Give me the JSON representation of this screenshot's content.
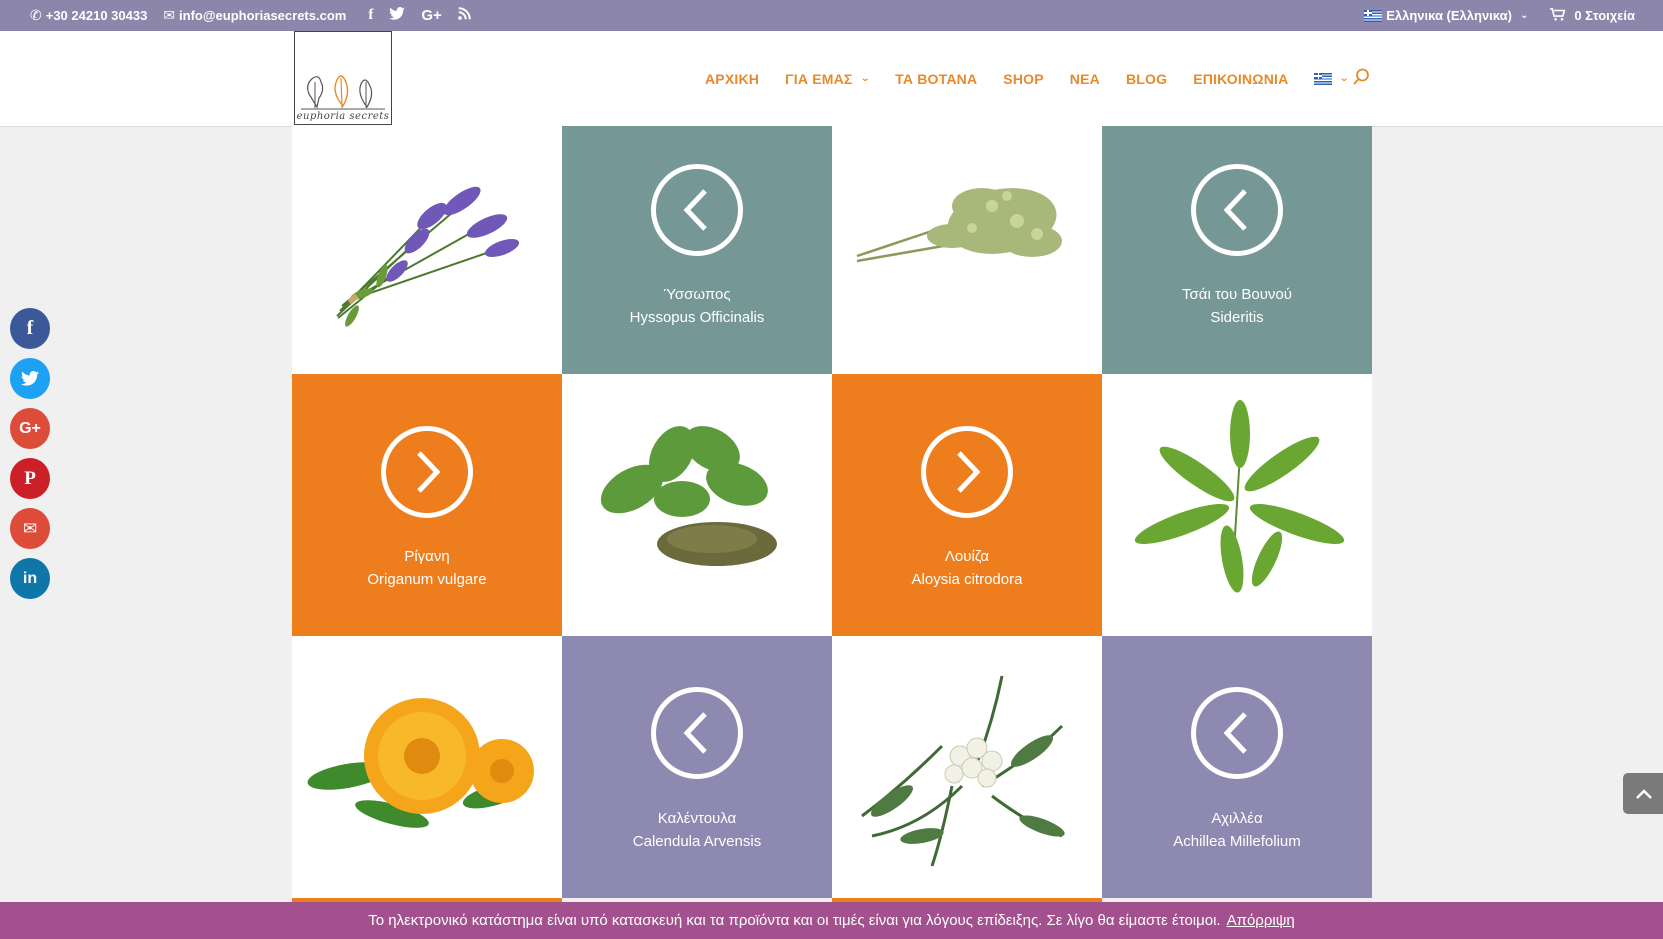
{
  "topbar": {
    "phone": "+30 24210 30433",
    "email": "info@euphoriasecrets.com",
    "social_icons": [
      "facebook-icon",
      "twitter-icon",
      "google-plus-icon",
      "rss-icon"
    ],
    "language": "Ελληνικα (Ελληνικα)",
    "cart": "0 Στοιχεία",
    "bg_color": "#8c86ab"
  },
  "logo": {
    "text": "euphoria secrets"
  },
  "nav": {
    "items": [
      {
        "label": "ΑΡΧΙΚΗ",
        "has_dropdown": false
      },
      {
        "label": "ΓΙΑ ΕΜΑΣ",
        "has_dropdown": true
      },
      {
        "label": "ΤΑ ΒΟΤΑΝΑ",
        "has_dropdown": false
      },
      {
        "label": "SHOP",
        "has_dropdown": false
      },
      {
        "label": "ΝΕΑ",
        "has_dropdown": false
      },
      {
        "label": "BLOG",
        "has_dropdown": false
      },
      {
        "label": "ΕΠΙΚΟΙΝΩΝΙΑ",
        "has_dropdown": false
      }
    ],
    "accent": "#e88a2b"
  },
  "herbs": [
    {
      "greek": "Ύσσωπος",
      "latin": "Hyssopus Officinalis",
      "color": "#759795",
      "arrow": "left"
    },
    {
      "greek": "Τσάι του Βουνού",
      "latin": "Sideritis",
      "color": "#759795",
      "arrow": "left"
    },
    {
      "greek": "Ρίγανη",
      "latin": "Origanum vulgare",
      "color": "#ee7d1e",
      "arrow": "right"
    },
    {
      "greek": "Λουίζα",
      "latin": "Aloysia citrodora",
      "color": "#ee7d1e",
      "arrow": "right"
    },
    {
      "greek": "Καλέντουλα",
      "latin": "Calendula Arvensis",
      "color": "#8e89b1",
      "arrow": "left"
    },
    {
      "greek": "Αχιλλέα",
      "latin": "Achillea Millefolium",
      "color": "#8e89b1",
      "arrow": "left"
    }
  ],
  "share_buttons": [
    {
      "name": "facebook",
      "glyph": "f",
      "color": "#3b5998"
    },
    {
      "name": "twitter",
      "glyph": "t",
      "color": "#1da1f2"
    },
    {
      "name": "google-plus",
      "glyph": "G+",
      "color": "#dd4b39"
    },
    {
      "name": "pinterest",
      "glyph": "P",
      "color": "#cb2027"
    },
    {
      "name": "email",
      "glyph": "✉",
      "color": "#dd4b39"
    },
    {
      "name": "linkedin",
      "glyph": "in",
      "color": "#0e76a8"
    }
  ],
  "notice": {
    "text": "Το ηλεκτρονικό κατάστημα είναι υπό κατασκευή και τα προϊόντα και οι τιμές είναι για λόγους επίδειξης. Σε λίγο θα είμαστε έτοιμοι.",
    "dismiss": "Απόρριψη"
  }
}
